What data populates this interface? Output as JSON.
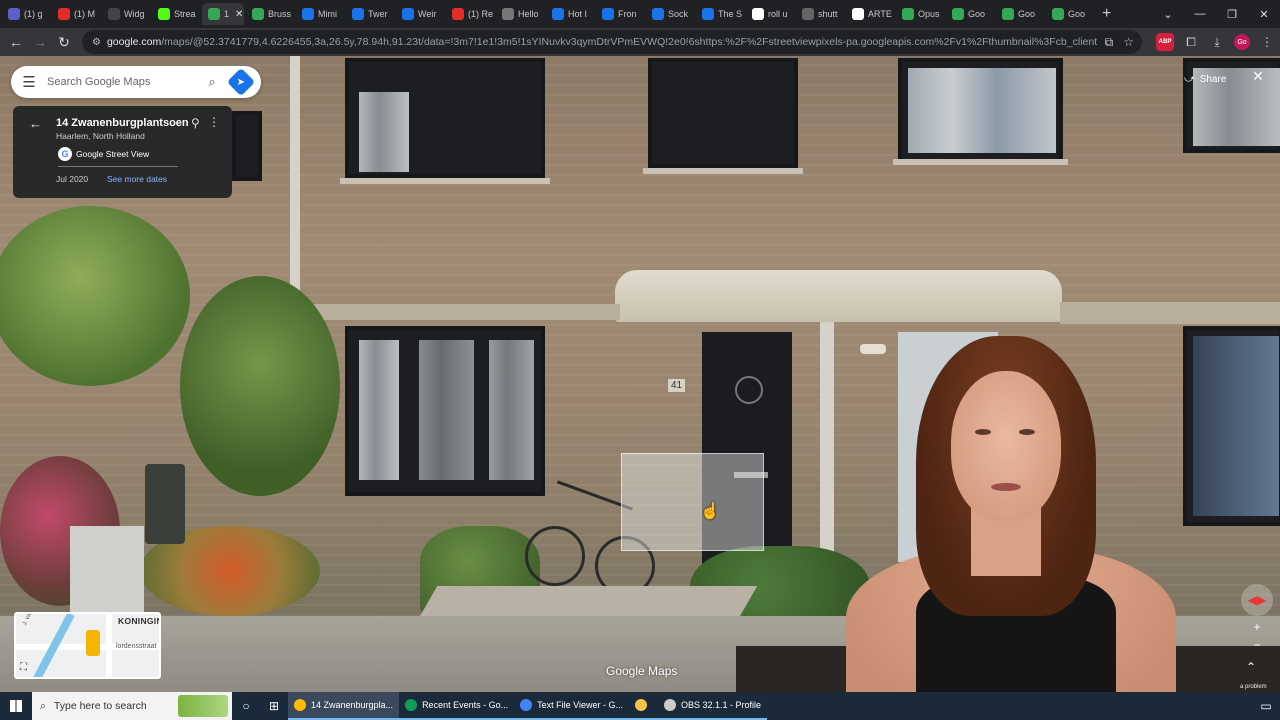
{
  "browser": {
    "tabs": [
      {
        "label": "(1) g",
        "icon": "teams-icon",
        "color": "#5b5fc7"
      },
      {
        "label": "(1) M",
        "icon": "youtube-icon",
        "color": "#e52d27"
      },
      {
        "label": "Widg",
        "icon": "widget-icon",
        "color": "#444"
      },
      {
        "label": "Strea",
        "icon": "kick-icon",
        "color": "#53fc18"
      },
      {
        "label": "1",
        "icon": "maps-icon",
        "color": "#34a853",
        "active": true
      },
      {
        "label": "Bruss",
        "icon": "maps-icon",
        "color": "#34a853"
      },
      {
        "label": "Mimi",
        "icon": "gif-icon",
        "color": "#1a73e8"
      },
      {
        "label": "Twer",
        "icon": "gif-icon",
        "color": "#1a73e8"
      },
      {
        "label": "Weir",
        "icon": "gif-icon",
        "color": "#1a73e8"
      },
      {
        "label": "(1) Re",
        "icon": "youtube-icon",
        "color": "#e52d27"
      },
      {
        "label": "Hello",
        "icon": "page-icon",
        "color": "#777"
      },
      {
        "label": "Hot I",
        "icon": "gif-icon",
        "color": "#1a73e8"
      },
      {
        "label": "Fron",
        "icon": "gif-icon",
        "color": "#1a73e8"
      },
      {
        "label": "Sock",
        "icon": "gif-icon",
        "color": "#1a73e8"
      },
      {
        "label": "The S",
        "icon": "gif-icon",
        "color": "#1a73e8"
      },
      {
        "label": "roll u",
        "icon": "google-icon",
        "color": "#fff"
      },
      {
        "label": "shutt",
        "icon": "loading-icon",
        "color": "#666"
      },
      {
        "label": "ARTE",
        "icon": "google-icon",
        "color": "#fff"
      },
      {
        "label": "Opus",
        "icon": "maps-icon",
        "color": "#34a853"
      },
      {
        "label": "Goo",
        "icon": "maps-icon",
        "color": "#34a853"
      },
      {
        "label": "Goo",
        "icon": "maps-icon",
        "color": "#34a853"
      },
      {
        "label": "Goo",
        "icon": "maps-icon",
        "color": "#34a853"
      }
    ],
    "url_main": "google.com",
    "url_rest": "/maps/@52.3741779,4.6226455,3a,26.5y,78.94h,91.23t/data=!3m7!1e1!3m5!1sYINuvkv3qymDtrVPmEVWQ!2e0!6shttps:%2F%2Fstreetviewpixels-pa.googleapis.com%2Fv1%2Fthumbnail%3Fcb_client%3Dmaps_sv.tactile%26w%..."
  },
  "maps": {
    "search_placeholder": "Search Google Maps",
    "place_title": "14 Zwanenburgplantsoen",
    "place_subtitle": "Haarlem, North Holland",
    "source": "Google Street View",
    "date": "Jul 2020",
    "see_more_dates": "See more dates",
    "share_label": "Share",
    "watermark": "Google Maps",
    "house_number": "41",
    "minimap": {
      "label_top": "KONINGIN",
      "label_street": "lordensstraat",
      "label_side": "J. van Manderstr."
    },
    "problem_text": "a problem"
  },
  "taskbar": {
    "search_placeholder": "Type here to search",
    "apps": [
      {
        "label": "14 Zwanenburgpla...",
        "color": "#fbbc05",
        "active": true
      },
      {
        "label": "Recent Events - Go...",
        "color": "#0f9d58"
      },
      {
        "label": "Text File Viewer - G...",
        "color": "#4285f4"
      },
      {
        "label": "",
        "color": "#f6c244"
      },
      {
        "label": "OBS 32.1.1 - Profile",
        "color": "#ccc"
      }
    ]
  }
}
